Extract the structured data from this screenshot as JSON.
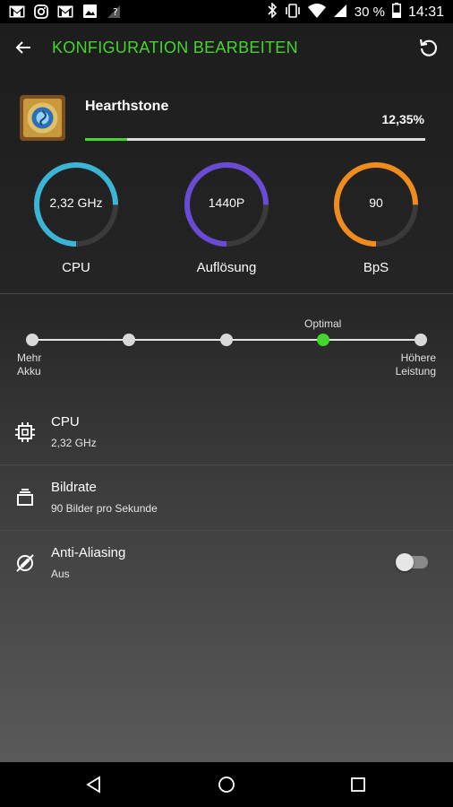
{
  "status_bar": {
    "left_icons": [
      "gmail-icon",
      "instagram-icon",
      "gmail-icon",
      "image-icon",
      "signal-question-icon"
    ],
    "right_icons": [
      "bluetooth-icon",
      "vibrate-icon",
      "wifi-icon",
      "cell-signal-icon"
    ],
    "battery": "30 %",
    "time": "14:31"
  },
  "header": {
    "title": "KONFIGURATION BEARBEITEN",
    "accent": "#44d62c"
  },
  "game": {
    "name": "Hearthstone",
    "percent_text": "12,35%",
    "progress_fraction": 0.1235
  },
  "gauges": [
    {
      "value": "2,32 GHz",
      "label": "CPU",
      "color": "#3bb5d6",
      "fill": 0.75
    },
    {
      "value": "1440P",
      "label": "Auflösung",
      "color": "#6a4bd6",
      "fill": 0.75
    },
    {
      "value": "90",
      "label": "BpS",
      "color": "#f08c1e",
      "fill": 0.75
    }
  ],
  "performance_slider": {
    "steps": 5,
    "selected_index": 3,
    "selected_label": "Optimal",
    "left_label": [
      "Mehr",
      "Akku"
    ],
    "right_label": [
      "Höhere",
      "Leistung"
    ]
  },
  "settings": [
    {
      "icon": "chip-icon",
      "name": "CPU",
      "value": "2,32 GHz"
    },
    {
      "icon": "frames-icon",
      "name": "Bildrate",
      "value": "90 Bilder pro Sekunde"
    },
    {
      "icon": "anti-aliasing-off-icon",
      "name": "Anti-Aliasing",
      "value": "Aus",
      "toggle_on": false
    }
  ],
  "nav_bar": [
    "back-triangle-icon",
    "home-circle-icon",
    "recents-square-icon"
  ]
}
